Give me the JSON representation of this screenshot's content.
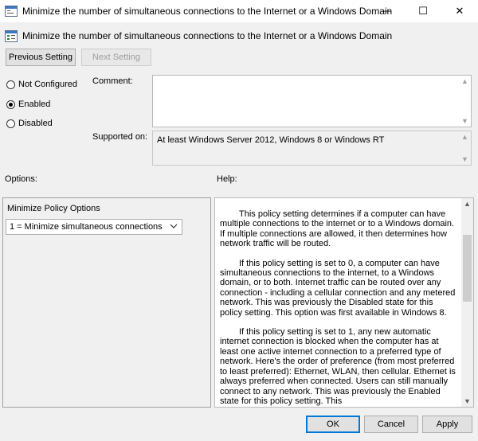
{
  "window": {
    "title": "Minimize the number of simultaneous connections to the Internet or a Windows Domain",
    "minimize_glyph": "—",
    "maximize_glyph": "☐",
    "close_glyph": "✕"
  },
  "header": {
    "policy_title": "Minimize the number of simultaneous connections to the Internet or a Windows Domain"
  },
  "nav": {
    "previous_label": "Previous Setting",
    "next_label": "Next Setting"
  },
  "state": {
    "options": [
      {
        "label": "Not Configured",
        "selected": false
      },
      {
        "label": "Enabled",
        "selected": true
      },
      {
        "label": "Disabled",
        "selected": false
      }
    ]
  },
  "comment": {
    "label": "Comment:",
    "value": ""
  },
  "supported": {
    "label": "Supported on:",
    "value": "At least Windows Server 2012, Windows 8 or Windows RT"
  },
  "options_panel": {
    "heading": "Options:",
    "group_label": "Minimize Policy Options",
    "selected_value": "1 = Minimize simultaneous connections"
  },
  "help_panel": {
    "heading": "Help:",
    "paragraphs": [
      "This policy setting determines if a computer can have multiple connections to the internet or to a Windows domain. If multiple connections are allowed, it then determines how network traffic will be routed.",
      "If this policy setting is set to 0, a computer can have simultaneous connections to the internet, to a Windows domain, or to both. Internet traffic can be routed over any connection - including a cellular connection and any metered network. This was previously the Disabled state for this policy setting. This option was first available in Windows 8.",
      "If this policy setting is set to 1, any new automatic internet connection is blocked when the computer has at least one active internet connection to a preferred type of network. Here's the order of preference (from most preferred to least preferred): Ethernet, WLAN, then cellular. Ethernet is always preferred when connected. Users can still manually connect to any network. This was previously the Enabled state for this policy setting. This"
    ]
  },
  "footer": {
    "ok_label": "OK",
    "cancel_label": "Cancel",
    "apply_label": "Apply"
  }
}
